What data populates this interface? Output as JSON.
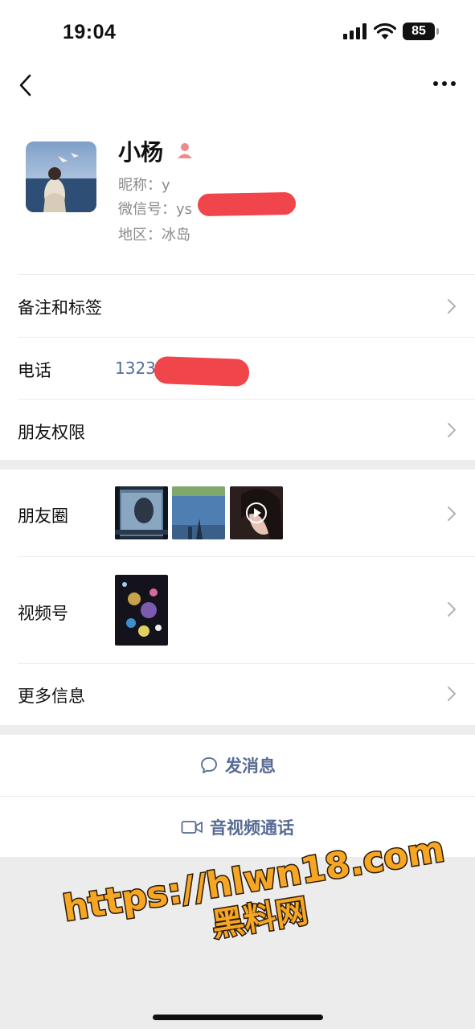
{
  "status_bar": {
    "time": "19:04",
    "battery": "85"
  },
  "contact": {
    "name": "小杨",
    "nickname": "昵称：y",
    "wechat_id": "微信号：ys",
    "region": "地区：冰岛"
  },
  "rows": {
    "remarks_label": "备注和标签",
    "phone_label": "电话",
    "phone_value": "1323",
    "permissions_label": "朋友权限",
    "moments_label": "朋友圈",
    "channels_label": "视频号",
    "more_info_label": "更多信息"
  },
  "actions": {
    "message_label": "发消息",
    "call_label": "音视频通话"
  },
  "watermark": {
    "url": "https://hlwn18.com",
    "site": "黑料网"
  },
  "colors": {
    "link_blue": "#576b95",
    "redaction_red": "#f0454a",
    "watermark_orange": "#f6a623"
  }
}
